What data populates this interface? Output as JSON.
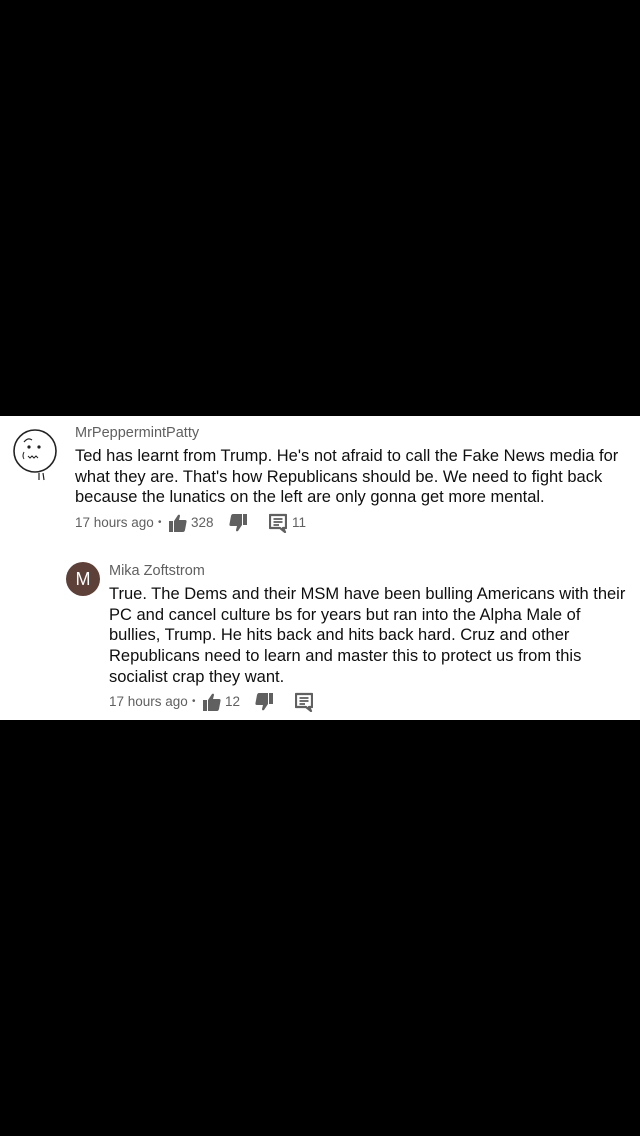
{
  "comments": [
    {
      "author": "MrPeppermintPatty",
      "avatar": "doodle-avatar",
      "text": "Ted has learnt from Trump. He's not afraid to call the Fake News media for what they are. That's how Republicans should be. We need to fight back because the lunatics on the left are only gonna get more mental.",
      "timestamp": "17 hours ago",
      "separator": "•",
      "likes": "328",
      "replies": "11"
    },
    {
      "author": "Mika Zoftstrom",
      "avatar_letter": "M",
      "avatar_color": "#5d4037",
      "text": "True. The Dems and their MSM have been bulling Americans with their PC and cancel culture bs for years but ran into the Alpha Male of bullies, Trump. He hits back and hits back hard. Cruz and other Republicans need to learn and master this to protect us from this socialist crap they want.",
      "timestamp": "17 hours ago",
      "separator": "•",
      "likes": "12",
      "replies": ""
    }
  ],
  "icons": {
    "like": "thumbs-up-icon",
    "dislike": "thumbs-down-icon",
    "reply": "comment-icon"
  }
}
